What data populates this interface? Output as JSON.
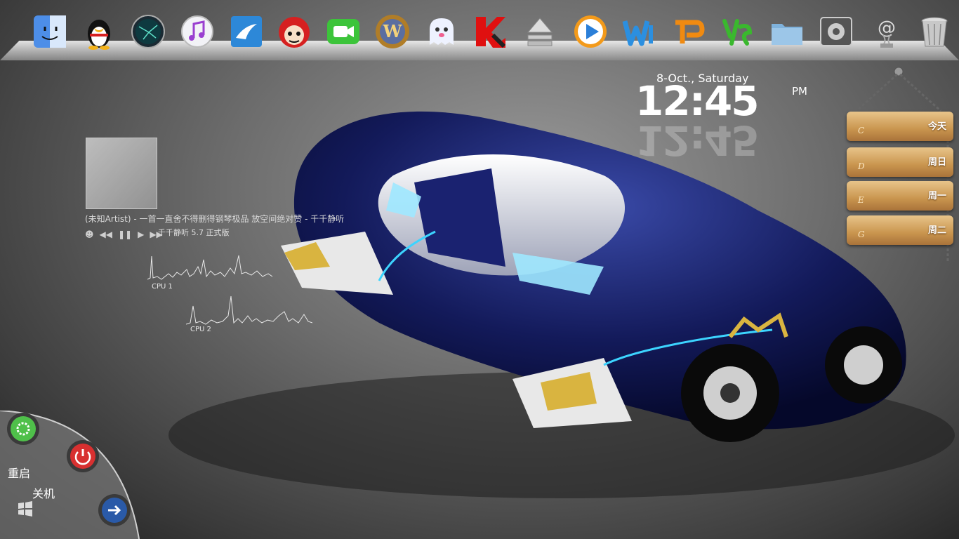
{
  "dock": {
    "items": [
      {
        "name": "finder",
        "icon": "finder-icon"
      },
      {
        "name": "qq",
        "icon": "qq-penguin-icon"
      },
      {
        "name": "globe",
        "icon": "globe-icon"
      },
      {
        "name": "itunes",
        "icon": "music-note-icon"
      },
      {
        "name": "browser",
        "icon": "bird-browser-icon"
      },
      {
        "name": "cartoon",
        "icon": "red-cartoon-icon"
      },
      {
        "name": "facetime",
        "icon": "video-camera-icon"
      },
      {
        "name": "warcraft",
        "icon": "warcraft-w-icon",
        "letter": "W"
      },
      {
        "name": "ghost",
        "icon": "ghost-icon"
      },
      {
        "name": "kaspersky",
        "icon": "kaspersky-k-icon"
      },
      {
        "name": "eject",
        "icon": "eject-icon"
      },
      {
        "name": "media-player",
        "icon": "play-icon"
      },
      {
        "name": "wps-writer",
        "icon": "wps-w-icon"
      },
      {
        "name": "wps-presentation",
        "icon": "wps-p-icon"
      },
      {
        "name": "wps-spreadsheet",
        "icon": "wps-s-icon"
      },
      {
        "name": "folder",
        "icon": "folder-icon"
      },
      {
        "name": "system-preferences",
        "icon": "settings-gear-icon"
      },
      {
        "name": "mail",
        "icon": "mail-at-icon"
      },
      {
        "name": "trash",
        "icon": "trash-icon"
      }
    ]
  },
  "clock": {
    "date": "8-Oct., Saturday",
    "time": "12:45",
    "ampm": "PM"
  },
  "calendar": {
    "boards": [
      {
        "label": "今天",
        "letter": "C"
      },
      {
        "label": "周日",
        "letter": "D"
      },
      {
        "label": "周一",
        "letter": "E"
      },
      {
        "label": "周二",
        "letter": "G"
      }
    ]
  },
  "music": {
    "track": "(未知Artist) - 一首一直舍不得删得钢琴极品 放空间绝对赞 - 千千静听",
    "player": "千千静听 5.7 正式版"
  },
  "cpu": {
    "cpu1_label": "CPU 1",
    "cpu2_label": "CPU 2"
  },
  "shutdown_panel": {
    "restart": "重启",
    "shutdown": "关机"
  },
  "colors": {
    "accent_blue": "#1e2a7a",
    "wood": "#c9954e"
  }
}
